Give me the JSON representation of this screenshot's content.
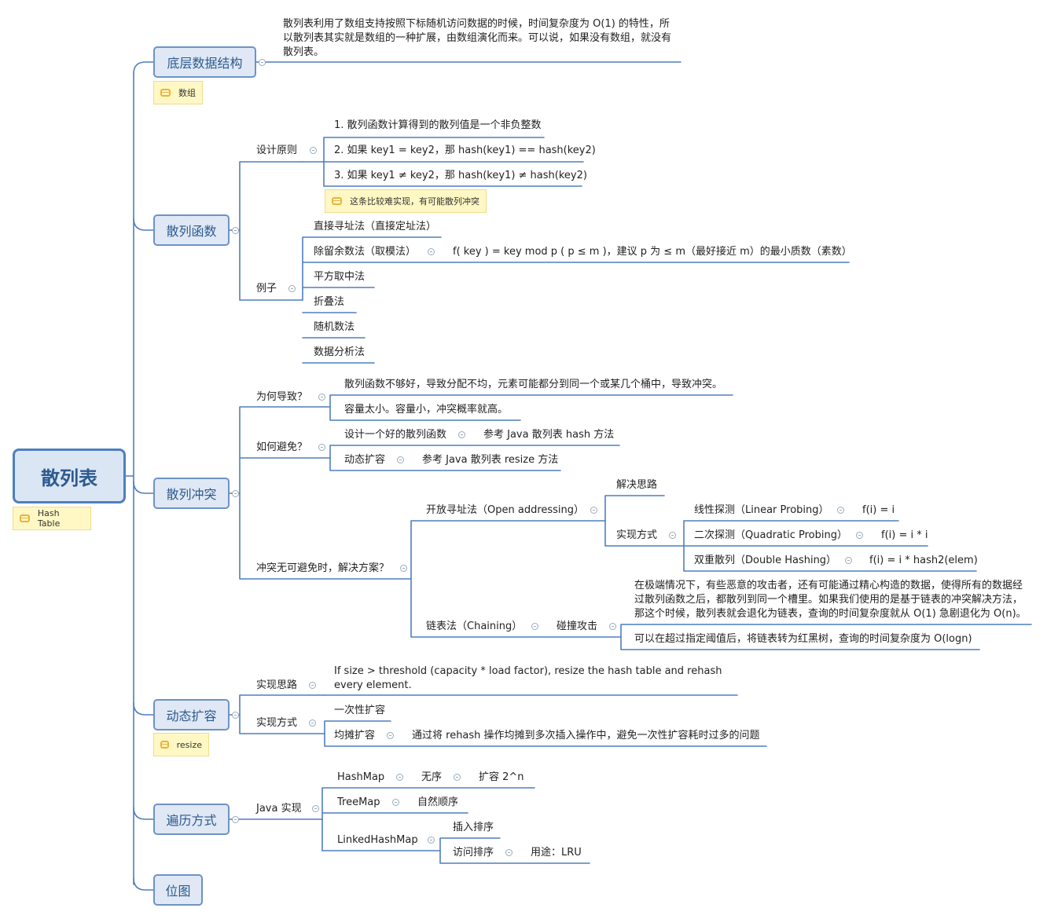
{
  "root": {
    "title": "散列表",
    "note": "Hash Table"
  },
  "n1": {
    "title": "底层数据结构",
    "note": "数组",
    "desc": "散列表利用了数组支持按照下标随机访问数据的时候，时间复杂度为 O(1) 的特性，所以散列表其实就是数组的一种扩展，由数组演化而来。可以说，如果没有数组，就没有散列表。"
  },
  "n2": {
    "title": "散列函数",
    "design": "设计原则",
    "d1": "1. 散列函数计算得到的散列值是一个非负整数",
    "d2": "2. 如果 key1 = key2，那 hash(key1) == hash(key2)",
    "d3": "3. 如果 key1 ≠ key2，那 hash(key1) ≠ hash(key2)",
    "d3note": "这条比较难实现，有可能散列冲突",
    "examples": "例子",
    "e1": "直接寻址法（直接定址法）",
    "e2": "除留余数法（取模法）",
    "e2detail": "f( key ) = key mod p ( p ≤ m )，建议 p 为 ≤ m（最好接近 m）的最小质数（素数）",
    "e3": "平方取中法",
    "e4": "折叠法",
    "e5": "随机数法",
    "e6": "数据分析法"
  },
  "n3": {
    "title": "散列冲突",
    "why": "为何导致？",
    "why1": "散列函数不够好，导致分配不均，元素可能都分到同一个或某几个桶中，导致冲突。",
    "why2": "容量太小。容量小，冲突概率就高。",
    "avoid": "如何避免？",
    "a1": "设计一个好的散列函数",
    "a1ref": "参考 Java 散列表 hash 方法",
    "a2": "动态扩容",
    "a2ref": "参考 Java 散列表 resize 方法",
    "solve": "冲突无可避免时，解决方案？",
    "open": "开放寻址法（Open addressing）",
    "idea": "解决思路",
    "impl": "实现方式",
    "lin": "线性探测（Linear Probing）",
    "linf": "f(i) = i",
    "quad": "二次探测（Quadratic Probing）",
    "quadf": "f(i) = i * i",
    "dbl": "双重散列（Double Hashing）",
    "dblf": "f(i) = i * hash2(elem)",
    "chain": "链表法（Chaining）",
    "attack": "碰撞攻击",
    "attack1": "在极端情况下，有些恶意的攻击者，还有可能通过精心构造的数据，使得所有的数据经过散列函数之后，都散列到同一个槽里。如果我们使用的是基于链表的冲突解决方法，那这个时候，散列表就会退化为链表，查询的时间复杂度就从 O(1) 急剧退化为 O(n)。",
    "attack2": "可以在超过指定阈值后，将链表转为红黑树，查询的时间复杂度为 O(logn)"
  },
  "n4": {
    "title": "动态扩容",
    "note": "resize",
    "idea": "实现思路",
    "ideaText": "If size > threshold (capacity * load factor), resize the hash table and rehash every element.",
    "impl": "实现方式",
    "i1": "一次性扩容",
    "i2": "均摊扩容",
    "i2detail": "通过将 rehash 操作均摊到多次插入操作中，避免一次性扩容耗时过多的问题"
  },
  "n5": {
    "title": "遍历方式",
    "java": "Java 实现",
    "hm": "HashMap",
    "hm1": "无序",
    "hm2": "扩容 2^n",
    "tm": "TreeMap",
    "tm1": "自然顺序",
    "lhm": "LinkedHashMap",
    "lhm1": "插入排序",
    "lhm2": "访问排序",
    "lhm2a": "用途：LRU"
  },
  "n6": {
    "title": "位图"
  },
  "colors": {
    "line": "#4f7fbf",
    "mainBorder": "#6e93c4",
    "mainFill": "#dfe8f4",
    "note": "#fff8c4",
    "noteIcon": "#e8b33c"
  }
}
